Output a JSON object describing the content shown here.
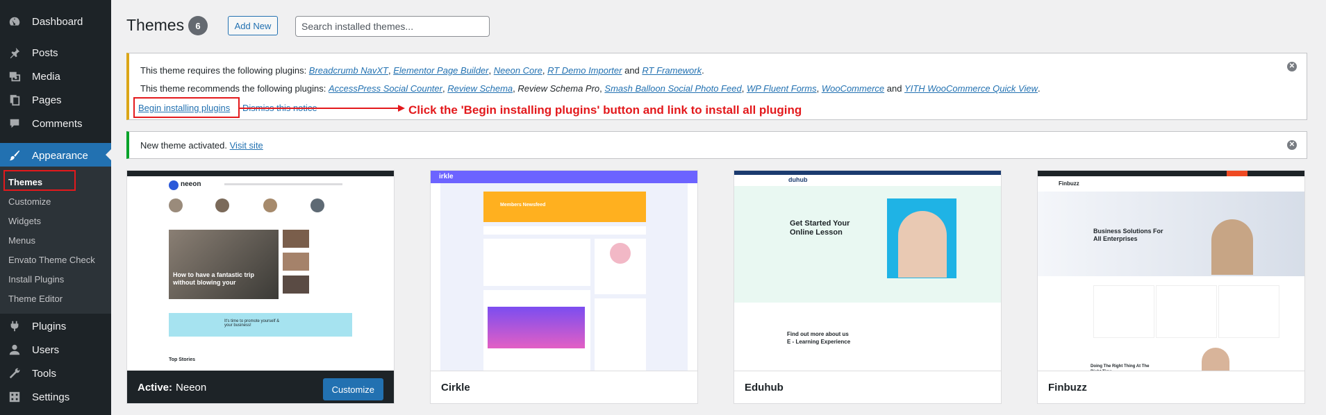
{
  "sidebar": {
    "items": [
      {
        "label": "Dashboard",
        "icon": "dashboard-icon"
      },
      {
        "label": "Posts",
        "icon": "pin-icon"
      },
      {
        "label": "Media",
        "icon": "media-icon"
      },
      {
        "label": "Pages",
        "icon": "pages-icon"
      },
      {
        "label": "Comments",
        "icon": "comment-icon"
      },
      {
        "label": "Appearance",
        "icon": "brush-icon"
      },
      {
        "label": "Plugins",
        "icon": "plug-icon"
      },
      {
        "label": "Users",
        "icon": "user-icon"
      },
      {
        "label": "Tools",
        "icon": "wrench-icon"
      },
      {
        "label": "Settings",
        "icon": "settings-icon"
      }
    ],
    "submenu": [
      "Themes",
      "Customize",
      "Widgets",
      "Menus",
      "Envato Theme Check",
      "Install Plugins",
      "Theme Editor"
    ]
  },
  "header": {
    "title": "Themes",
    "count": "6",
    "add_new": "Add New",
    "search_placeholder": "Search installed themes..."
  },
  "notice_plugins": {
    "req_prefix": "This theme requires the following plugins: ",
    "required": [
      "Breadcrumb NavXT",
      "Elementor Page Builder",
      "Neeon Core",
      "RT Demo Importer",
      "RT Framework"
    ],
    "rec_prefix": "This theme recommends the following plugins: ",
    "recommended_a": [
      "AccessPress Social Counter",
      "Review Schema"
    ],
    "recommended_plain": "Review Schema Pro",
    "recommended_b": [
      "Smash Balloon Social Photo Feed",
      "WP Fluent Forms",
      "WooCommerce",
      "YITH WooCommerce Quick View"
    ],
    "sep": ", ",
    "and": " and ",
    "period": ".",
    "begin": "Begin installing plugins",
    "pipe": "|",
    "dismiss": "Dismiss this notice"
  },
  "annotation": "Click the 'Begin installing plugins' button and link to install all pluging",
  "notice_activated": {
    "text": "New theme activated. ",
    "link": "Visit site"
  },
  "themes": [
    {
      "name": "Neeon",
      "active_label": "Active:",
      "customize": "Customize"
    },
    {
      "name": "Cirkle"
    },
    {
      "name": "Eduhub"
    },
    {
      "name": "Finbuzz"
    }
  ],
  "previews": {
    "neeon": {
      "logo": "neeon",
      "hero": "How to have a fantastic trip without blowing your",
      "banner": "It's time to promote yourself & your business!",
      "top": "Top Stories"
    },
    "cirkle": {
      "logo": "irkle",
      "banner": "Members Newsfeed"
    },
    "eduhub": {
      "logo": "duhub",
      "heading": "Get Started Your Online Lesson",
      "find": "Find out more about us",
      "learn": "E - Learning Experience"
    },
    "finbuzz": {
      "logo": "Finbuzz",
      "heading": "Business Solutions For All Enterprises",
      "bottom": "Doing The Right Thing At The Right Time"
    }
  },
  "colors": {
    "accent": "#2271b1",
    "sidebar": "#1d2327",
    "warning": "#dba617",
    "success": "#00a32a",
    "annotation": "#e3191c"
  }
}
